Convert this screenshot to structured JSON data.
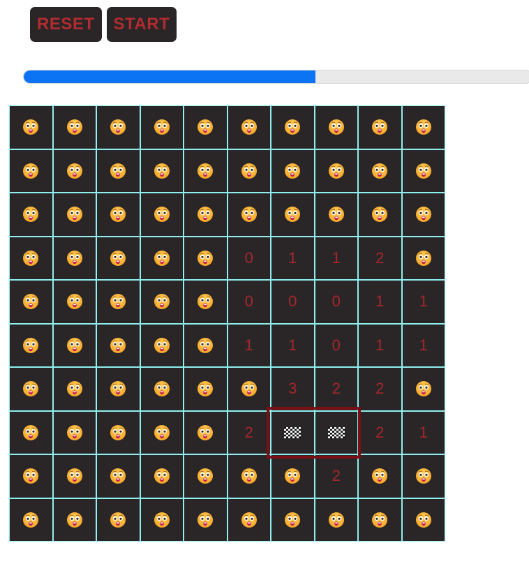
{
  "controls": {
    "reset_label": "RESET",
    "start_label": "START"
  },
  "progress": {
    "value_fraction": 0.574
  },
  "colors": {
    "button_bg": "#2a2627",
    "button_text": "#b22b2f",
    "progress_fill": "#0a74f5",
    "cell_bg": "#2a2627",
    "cell_border": "#8ff0ef",
    "number_text": "#a8272b",
    "selection_border": "#7a0f16"
  },
  "icons": {
    "hidden": "astonished-face-icon",
    "flag": "checkered-flag-icon"
  },
  "board": {
    "rows": [
      [
        "H",
        "H",
        "H",
        "H",
        "H",
        "H",
        "H",
        "H",
        "H",
        "H"
      ],
      [
        "H",
        "H",
        "H",
        "H",
        "H",
        "H",
        "H",
        "H",
        "H",
        "H"
      ],
      [
        "H",
        "H",
        "H",
        "H",
        "H",
        "H",
        "H",
        "H",
        "H",
        "H"
      ],
      [
        "H",
        "H",
        "H",
        "H",
        "H",
        "0",
        "1",
        "1",
        "2",
        "H"
      ],
      [
        "H",
        "H",
        "H",
        "H",
        "H",
        "0",
        "0",
        "0",
        "1",
        "1"
      ],
      [
        "H",
        "H",
        "H",
        "H",
        "H",
        "1",
        "1",
        "0",
        "1",
        "1"
      ],
      [
        "H",
        "H",
        "H",
        "H",
        "H",
        "H",
        "3",
        "2",
        "2",
        "H"
      ],
      [
        "H",
        "H",
        "H",
        "H",
        "H",
        "2",
        "F",
        "F",
        "2",
        "1"
      ],
      [
        "H",
        "H",
        "H",
        "H",
        "H",
        "H",
        "H",
        "2",
        "H",
        "H"
      ],
      [
        "H",
        "H",
        "H",
        "H",
        "H",
        "H",
        "H",
        "H",
        "H",
        "H"
      ]
    ]
  }
}
